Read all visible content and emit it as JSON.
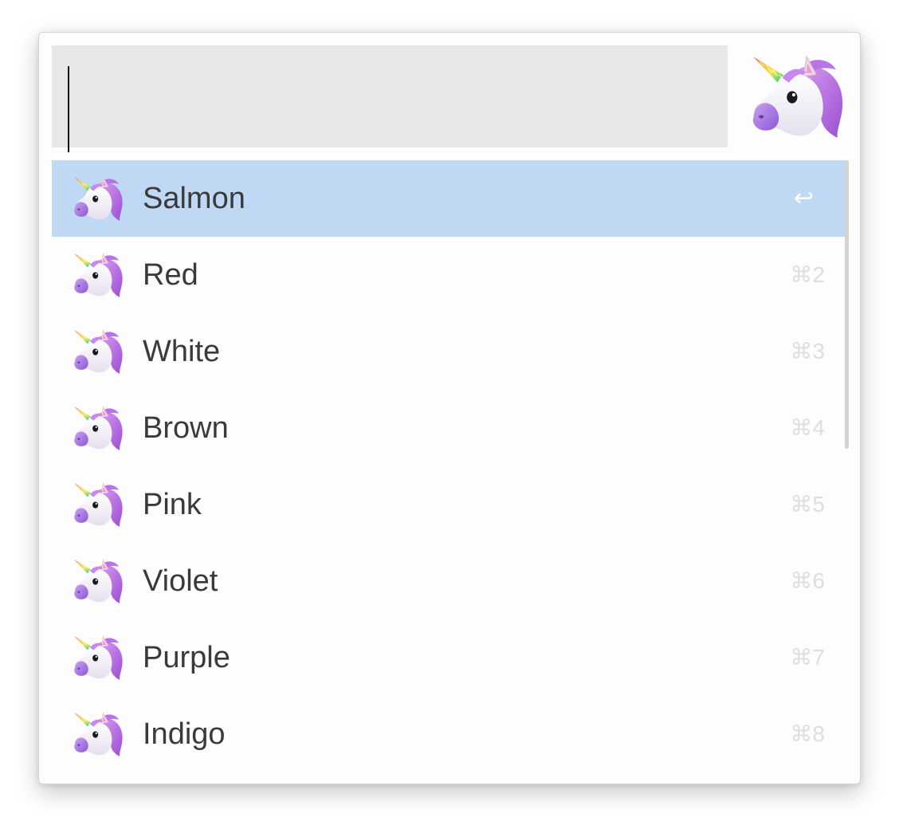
{
  "search": {
    "value": "",
    "placeholder": ""
  },
  "header_icon": "unicorn-icon",
  "results": [
    {
      "label": "Salmon",
      "shortcut": "↩",
      "icon": "unicorn-icon",
      "selected": true
    },
    {
      "label": "Red",
      "shortcut": "⌘2",
      "icon": "unicorn-icon",
      "selected": false
    },
    {
      "label": "White",
      "shortcut": "⌘3",
      "icon": "unicorn-icon",
      "selected": false
    },
    {
      "label": "Brown",
      "shortcut": "⌘4",
      "icon": "unicorn-icon",
      "selected": false
    },
    {
      "label": "Pink",
      "shortcut": "⌘5",
      "icon": "unicorn-icon",
      "selected": false
    },
    {
      "label": "Violet",
      "shortcut": "⌘6",
      "icon": "unicorn-icon",
      "selected": false
    },
    {
      "label": "Purple",
      "shortcut": "⌘7",
      "icon": "unicorn-icon",
      "selected": false
    },
    {
      "label": "Indigo",
      "shortcut": "⌘8",
      "icon": "unicorn-icon",
      "selected": false
    }
  ],
  "colors": {
    "selection": "#bfd8f4",
    "search_bg": "#e8e8e8",
    "text": "#3a3a3a",
    "shortcut": "#dedede"
  }
}
